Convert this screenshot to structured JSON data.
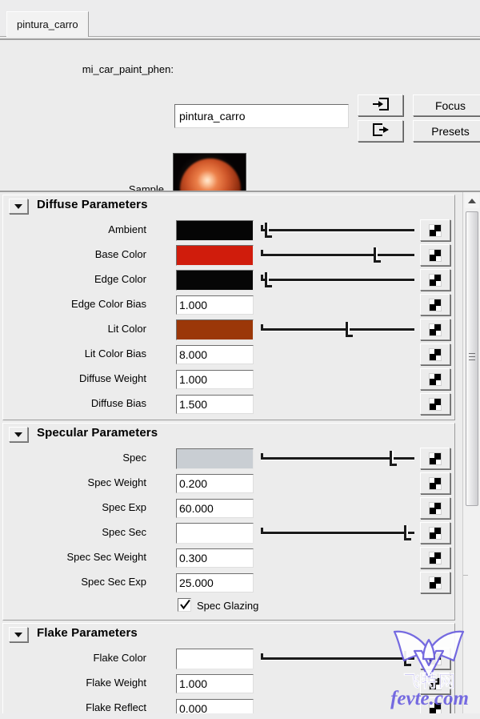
{
  "window": {
    "tab_label": "pintura_carro"
  },
  "header": {
    "shader_label": "mi_car_paint_phen:",
    "shader_name_value": "pintura_carro",
    "import_icon": "import-into-box-icon",
    "export_icon": "export-out-of-box-icon",
    "focus_label": "Focus",
    "presets_label": "Presets",
    "sample_label": "Sample"
  },
  "rollouts": [
    {
      "title": "Diffuse Parameters",
      "rows": [
        {
          "label": "Ambient",
          "type": "color",
          "color": "#050505",
          "slider": 3,
          "map_icon": "checker-map-icon"
        },
        {
          "label": "Base Color",
          "type": "color",
          "color": "#d01c0c",
          "slider": 77,
          "map_icon": "checker-map-icon"
        },
        {
          "label": "Edge Color",
          "type": "color",
          "color": "#060606",
          "slider": 3,
          "map_icon": "checker-map-icon"
        },
        {
          "label": "Edge Color Bias",
          "type": "number",
          "value": "1.000",
          "map_icon": "checker-map-icon"
        },
        {
          "label": "Lit Color",
          "type": "color",
          "color": "#9b3708",
          "slider": 58,
          "map_icon": "checker-map-icon"
        },
        {
          "label": "Lit Color Bias",
          "type": "number",
          "value": "8.000",
          "map_icon": "checker-map-icon"
        },
        {
          "label": "Diffuse Weight",
          "type": "number",
          "value": "1.000",
          "map_icon": "checker-map-icon"
        },
        {
          "label": "Diffuse Bias",
          "type": "number",
          "value": "1.500",
          "map_icon": "checker-map-icon"
        }
      ]
    },
    {
      "title": "Specular Parameters",
      "rows": [
        {
          "label": "Spec",
          "type": "color",
          "color": "#c9ced3",
          "slider": 88,
          "map_icon": "checker-map-icon"
        },
        {
          "label": "Spec Weight",
          "type": "number",
          "value": "0.200",
          "map_icon": "checker-map-icon"
        },
        {
          "label": "Spec Exp",
          "type": "number",
          "value": "60.000",
          "map_icon": "checker-map-icon"
        },
        {
          "label": "Spec Sec",
          "type": "color",
          "color": "#ffffff",
          "slider": 98,
          "map_icon": "checker-map-icon"
        },
        {
          "label": "Spec Sec Weight",
          "type": "number",
          "value": "0.300",
          "map_icon": "checker-map-icon"
        },
        {
          "label": "Spec Sec Exp",
          "type": "number",
          "value": "25.000",
          "map_icon": "checker-map-icon"
        }
      ],
      "checkbox": {
        "label": "Spec Glazing",
        "checked": true
      }
    },
    {
      "title": "Flake Parameters",
      "rows": [
        {
          "label": "Flake Color",
          "type": "color",
          "color": "#ffffff",
          "slider": 98,
          "map_icon": "checker-map-icon"
        },
        {
          "label": "Flake Weight",
          "type": "number",
          "value": "1.000",
          "map_icon": "checker-map-icon"
        },
        {
          "label": "Flake Reflect",
          "type": "number",
          "value": "0.000",
          "map_icon": "checker-map-icon"
        }
      ]
    }
  ],
  "scrollbar": {
    "up_arrow_icon": "chevron-up-icon"
  },
  "watermark": {
    "cn_text": "飞特网",
    "en_text": "fevte.com",
    "color": "#6b5fe0"
  }
}
